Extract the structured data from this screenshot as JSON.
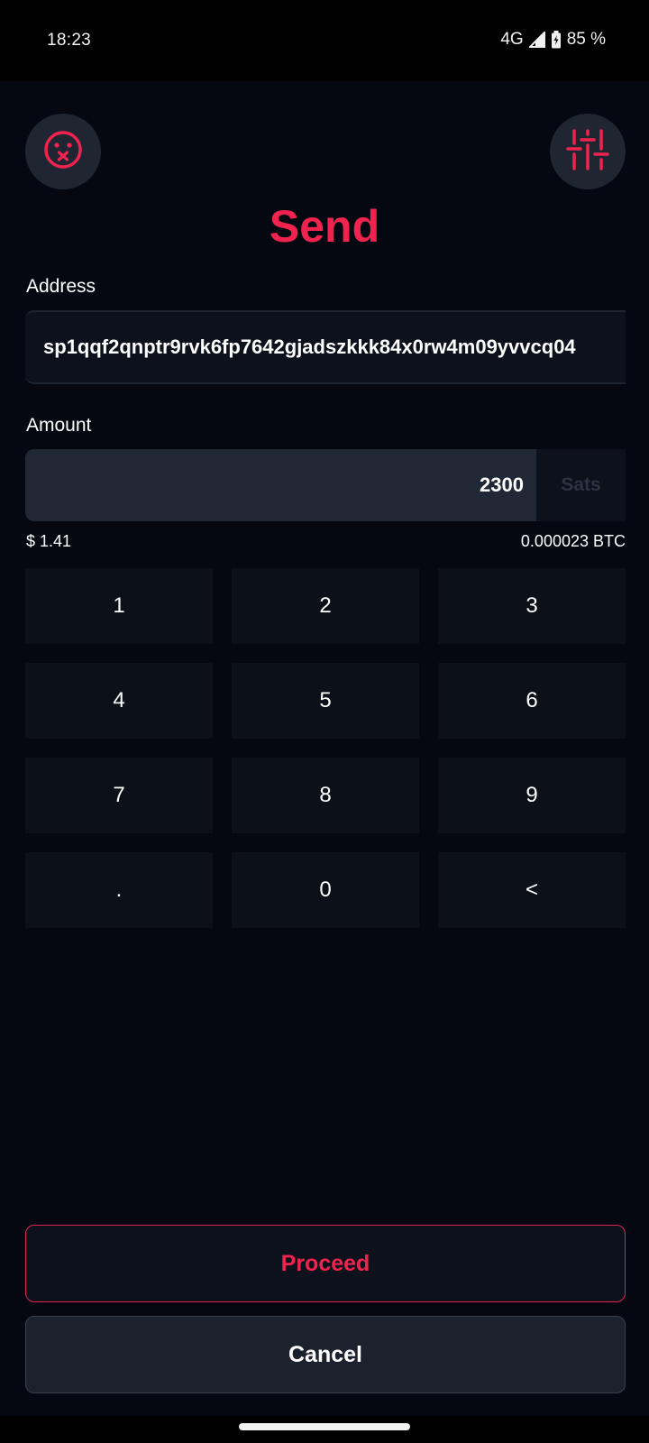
{
  "status_bar": {
    "time": "18:23",
    "network": "4G",
    "battery": "85 %",
    "icons": [
      "signal-icon",
      "battery-charging-icon"
    ]
  },
  "header": {
    "left_icon": "face-zipper-icon",
    "right_icon": "sliders-icon",
    "title": "Send"
  },
  "address": {
    "label": "Address",
    "value": "sp1qqf2qnptr9rvk6fp7642gjadszkkk84x0rw4m09yvvcq04"
  },
  "amount": {
    "label": "Amount",
    "value": "2300",
    "unit": "Sats",
    "fiat": "$ 1.41",
    "btc": "0.000023 BTC"
  },
  "keypad": [
    "1",
    "2",
    "3",
    "4",
    "5",
    "6",
    "7",
    "8",
    "9",
    ".",
    "0",
    "<"
  ],
  "actions": {
    "proceed": "Proceed",
    "cancel": "Cancel"
  },
  "colors": {
    "accent": "#f0234e",
    "background": "#050811",
    "key": "#0c1019",
    "input": "#202836"
  }
}
